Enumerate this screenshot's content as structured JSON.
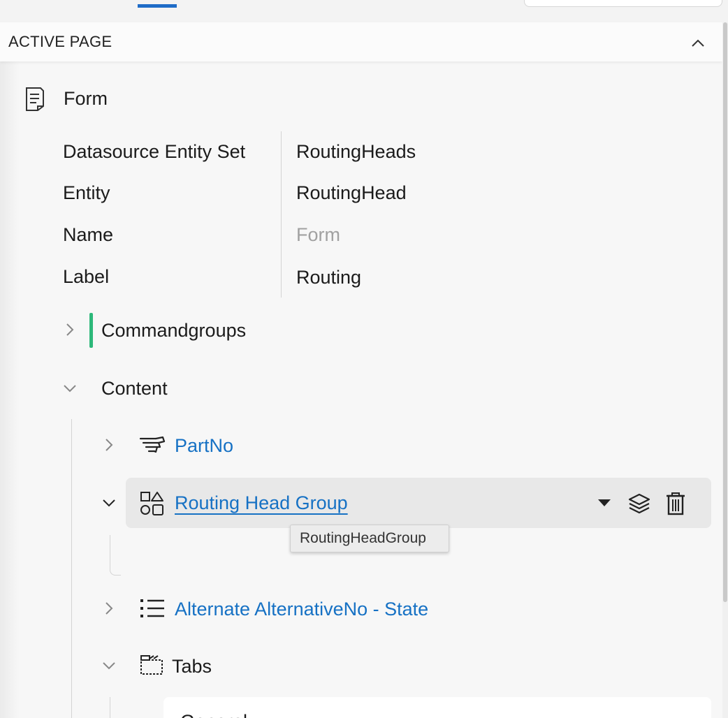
{
  "panel": {
    "title": "ACTIVE PAGE"
  },
  "form": {
    "title": "Form",
    "properties": [
      {
        "key": "Datasource Entity Set",
        "value": "RoutingHeads",
        "placeholder": false
      },
      {
        "key": "Entity",
        "value": "RoutingHead",
        "placeholder": false
      },
      {
        "key": "Name",
        "value": "Form",
        "placeholder": true
      },
      {
        "key": "Label",
        "value": "Routing",
        "placeholder": false
      }
    ]
  },
  "tree": {
    "commandgroups": "Commandgroups",
    "content": "Content",
    "partno": "PartNo",
    "routing_head_group": "Routing Head Group",
    "tooltip": "RoutingHeadGroup",
    "alternate": "Alternate AlternativeNo - State",
    "tabs": "Tabs",
    "tab_card_label": "General"
  },
  "icons": {
    "form": "document-icon",
    "partno": "hand-pointer-icon",
    "group": "shapes-icon",
    "alternate": "list-icon",
    "tabs": "film-tab-icon",
    "dropdown": "caret-down-icon",
    "layers": "layers-icon",
    "delete": "trash-icon",
    "collapse": "chevron-up-icon"
  },
  "colors": {
    "link": "#1671c4",
    "accent_green": "#2db87a",
    "tab_indicator": "#1f6cc7",
    "selected_row": "#e8e8e8"
  }
}
